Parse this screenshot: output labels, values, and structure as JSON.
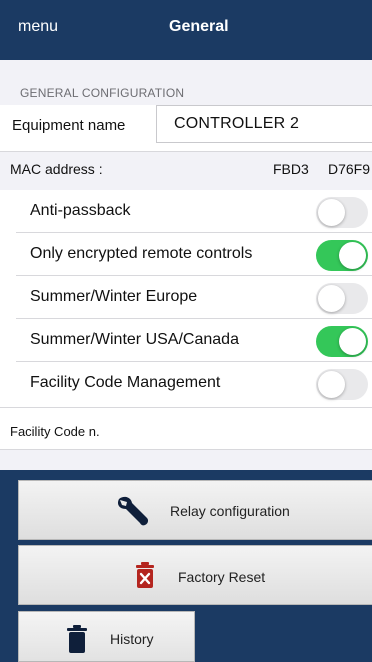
{
  "nav": {
    "menu_label": "menu",
    "title": "General"
  },
  "section": {
    "header": "GENERAL CONFIGURATION"
  },
  "equipment": {
    "label": "Equipment name",
    "value": "CONTROLLER 2"
  },
  "mac": {
    "label": "MAC address :",
    "part1": "FBD3",
    "part2": "D76F9"
  },
  "toggles": [
    {
      "label": "Anti-passback",
      "on": false
    },
    {
      "label": "Only encrypted remote controls",
      "on": true
    },
    {
      "label": "Summer/Winter Europe",
      "on": false
    },
    {
      "label": "Summer/Winter USA/Canada",
      "on": true
    },
    {
      "label": "Facility Code Management",
      "on": false
    }
  ],
  "facility_code": {
    "label": "Facility Code n."
  },
  "buttons": {
    "relay": {
      "label": "Relay configuration",
      "icon": "wrench-icon"
    },
    "reset": {
      "label": "Factory Reset",
      "icon": "trash-x-icon"
    },
    "history": {
      "label": "History",
      "icon": "trash-icon"
    }
  },
  "colors": {
    "nav": "#1b3a63",
    "switch_on": "#34c759",
    "switch_off": "#e9e9eb",
    "reset_red": "#b4251f"
  }
}
